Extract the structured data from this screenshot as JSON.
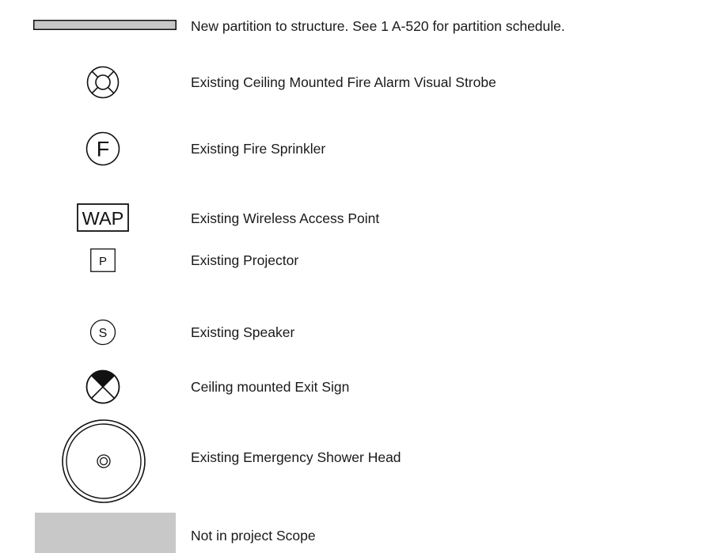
{
  "legend": {
    "items": [
      {
        "symbol": "new-partition-bar",
        "label": "New partition to structure.  See 1 A-520 for partition schedule."
      },
      {
        "symbol": "visual-strobe-icon",
        "label": "Existing Ceiling Mounted Fire Alarm Visual Strobe"
      },
      {
        "symbol": "fire-sprinkler-icon",
        "symbol_text": "F",
        "label": "Existing Fire Sprinkler"
      },
      {
        "symbol": "wireless-access-point-icon",
        "symbol_text": "WAP",
        "label": "Existing Wireless Access Point"
      },
      {
        "symbol": "projector-icon",
        "symbol_text": "P",
        "label": "Existing Projector"
      },
      {
        "symbol": "speaker-icon",
        "symbol_text": "S",
        "label": "Existing Speaker"
      },
      {
        "symbol": "exit-sign-icon",
        "label": "Ceiling mounted Exit Sign"
      },
      {
        "symbol": "emergency-shower-head-icon",
        "label": "Existing Emergency Shower Head"
      },
      {
        "symbol": "not-in-scope-swatch",
        "label": "Not in project Scope"
      }
    ]
  },
  "colors": {
    "line": "#111111",
    "partition_fill": "#c8c8c8",
    "scope_fill": "#c8c8c8"
  }
}
